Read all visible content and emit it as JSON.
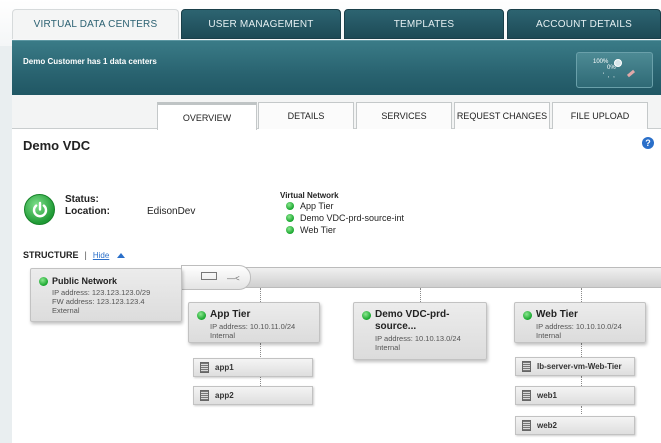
{
  "top_tabs": [
    {
      "label": "VIRTUAL DATA CENTERS",
      "active": true
    },
    {
      "label": "USER MANAGEMENT",
      "active": false
    },
    {
      "label": "TEMPLATES",
      "active": false
    },
    {
      "label": "ACCOUNT DETAILS",
      "active": false
    }
  ],
  "banner": {
    "text": "Demo Customer has 1 data centers",
    "gauge_left": "100%",
    "gauge_right": "0%"
  },
  "sub_tabs": [
    {
      "label": "OVERVIEW",
      "active": true
    },
    {
      "label": "DETAILS",
      "active": false
    },
    {
      "label": "SERVICES",
      "active": false
    },
    {
      "label": "REQUEST CHANGES",
      "active": false
    },
    {
      "label": "FILE UPLOAD",
      "active": false
    }
  ],
  "vdc": {
    "title": "Demo VDC",
    "help_glyph": "?",
    "status_label": "Status:",
    "location_label": "Location:",
    "location_value": "EdisonDev"
  },
  "virtual_network": {
    "title": "Virtual Network",
    "items": [
      "App Tier",
      "Demo VDC-prd-source-int",
      "Web Tier"
    ]
  },
  "structure": {
    "title": "STRUCTURE",
    "separator": "|",
    "hide_link": "Hide"
  },
  "public_network": {
    "name": "Public Network",
    "ip": "IP address: 123.123.123.0/29",
    "fw": "FW address: 123.123.123.4",
    "type": "External"
  },
  "tiers": [
    {
      "name": "App Tier",
      "ip": "IP address: 10.10.11.0/24",
      "type": "Internal",
      "vms": [
        "app1",
        "app2"
      ]
    },
    {
      "name_line1": "Demo VDC-prd-",
      "name_line2": "source...",
      "ip": "IP address: 10.10.13.0/24",
      "type": "Internal",
      "vms": []
    },
    {
      "name": "Web Tier",
      "ip": "IP address: 10.10.10.0/24",
      "type": "Internal",
      "vms": [
        "lb-server-vm-Web-Tier",
        "web1",
        "web2"
      ]
    }
  ],
  "colors": {
    "banner": "#296370",
    "status_green": "#16a52c",
    "link_blue": "#2a6fc9"
  }
}
